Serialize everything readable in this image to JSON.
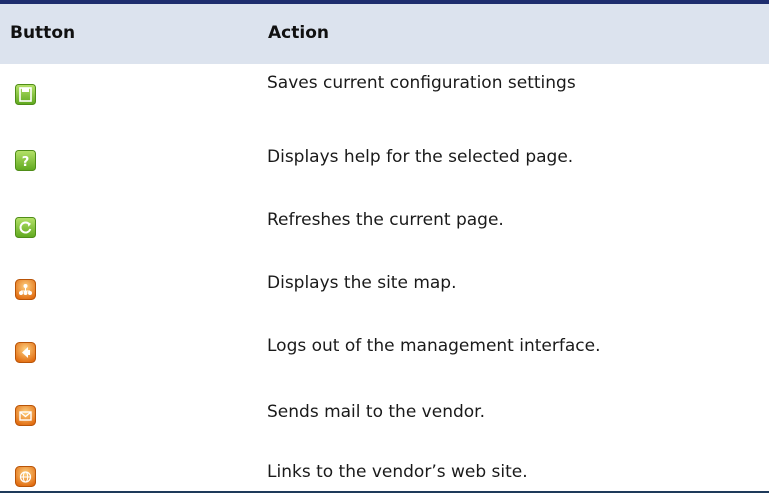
{
  "header": {
    "button_label": "Button",
    "action_label": "Action"
  },
  "rows": [
    {
      "icon": "save-icon",
      "action": "Saves current configuration settings"
    },
    {
      "icon": "help-icon",
      "action": "Displays help for the selected page."
    },
    {
      "icon": "refresh-icon",
      "action": "Refreshes the current page."
    },
    {
      "icon": "site-map-icon",
      "action": "Displays the site map."
    },
    {
      "icon": "logout-icon",
      "action": "Logs out of the management interface."
    },
    {
      "icon": "mail-icon",
      "action": "Sends mail to the vendor."
    },
    {
      "icon": "web-site-icon",
      "action": "Links to the vendor’s web site."
    }
  ],
  "colors": {
    "header_bg": "#dce3ee",
    "rule": "#1e2d6e",
    "green_icon": "#7cc234",
    "orange_icon": "#ef8a1a"
  }
}
